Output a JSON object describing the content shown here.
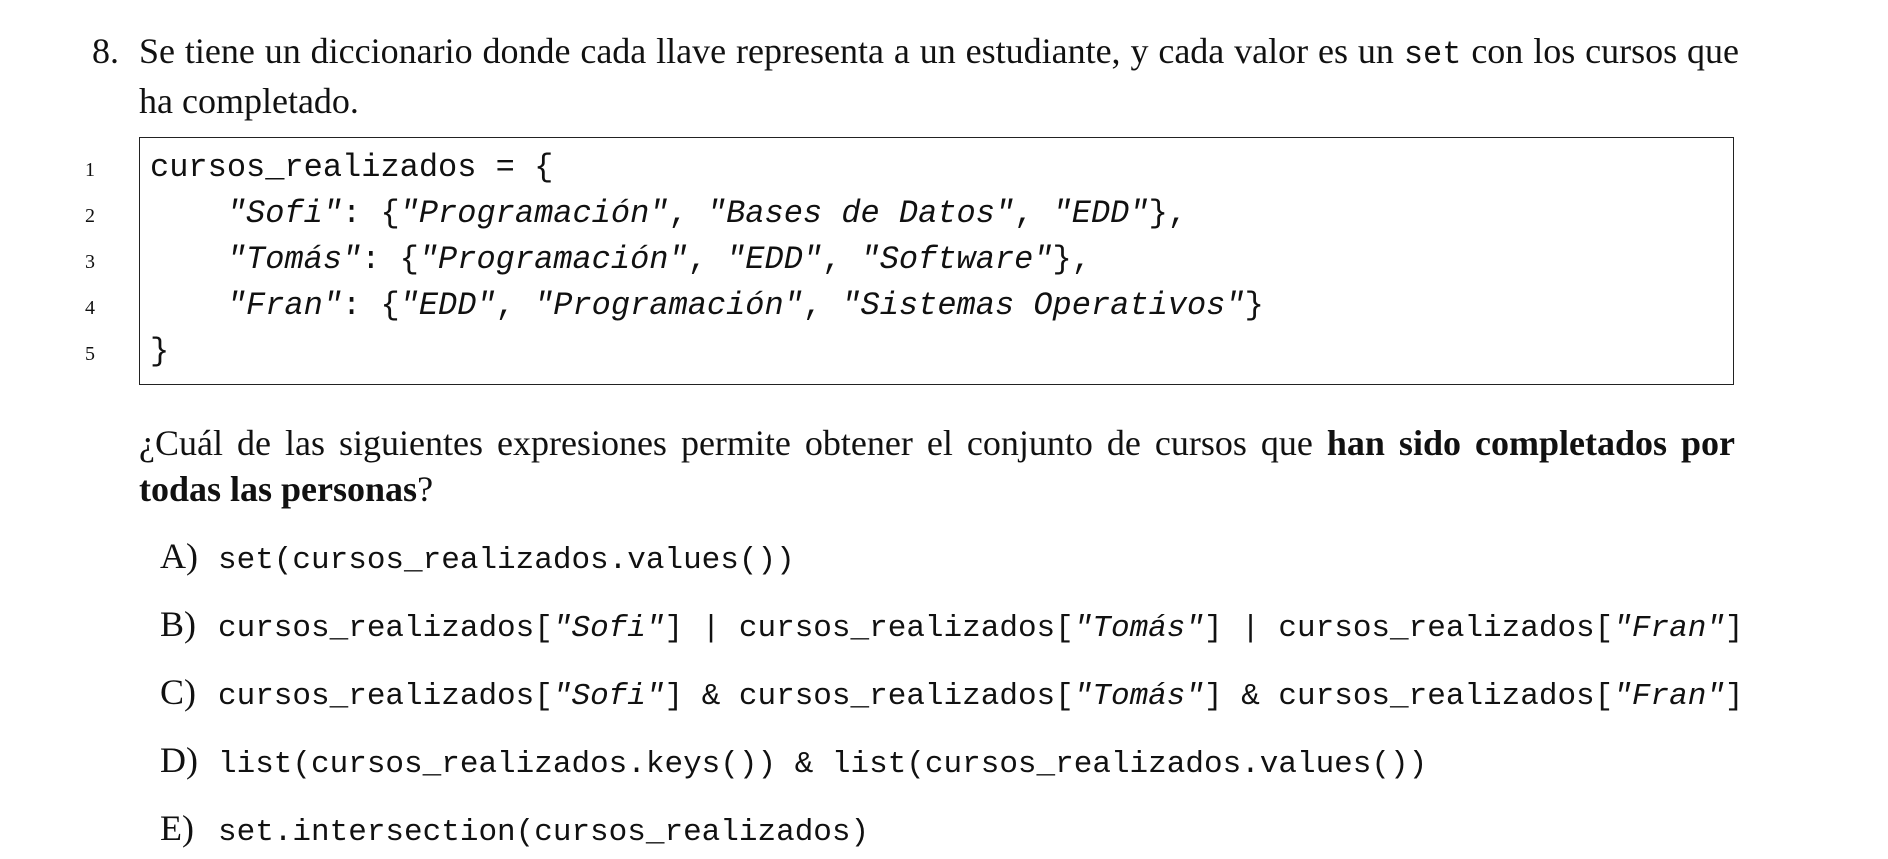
{
  "question": {
    "number": "8.",
    "text_before": "Se tiene un diccionario donde cada llave representa a un estudiante, y cada valor es un ",
    "inline_code": "set",
    "text_after": " con los cursos que ha completado."
  },
  "code": {
    "line_numbers": [
      "1",
      "2",
      "3",
      "4",
      "5"
    ],
    "line1": "cursos_realizados = {",
    "line2": {
      "indent": "    ",
      "key": "\"Sofi\"",
      "sep": ": {",
      "items": [
        "\"Programación\"",
        "\"Bases de Datos\"",
        "\"EDD\""
      ],
      "close": "},"
    },
    "line3": {
      "indent": "    ",
      "key": "\"Tomás\"",
      "sep": ": {",
      "items": [
        "\"Programación\"",
        "\"EDD\"",
        "\"Software\""
      ],
      "close": "},"
    },
    "line4": {
      "indent": "    ",
      "key": "\"Fran\"",
      "sep": ": {",
      "items": [
        "\"EDD\"",
        "\"Programación\"",
        "\"Sistemas Operativos\""
      ],
      "close": "}"
    },
    "line5": "}",
    "comma": ", "
  },
  "prompt": {
    "text_before": "¿Cuál de las siguientes expresiones permite obtener el conjunto de cursos que ",
    "bold": "han sido completados por todas las personas",
    "text_after": "?"
  },
  "options": {
    "a": {
      "letter": "A)",
      "code": "set(cursos_realizados.values())"
    },
    "b": {
      "letter": "B)",
      "p1": "cursos_realizados[",
      "s1": "\"Sofi\"",
      "p2": "] | cursos_realizados[",
      "s2": "\"Tomás\"",
      "p3": "] | cursos_realizados[",
      "s3": "\"Fran\"",
      "p4": "]"
    },
    "c": {
      "letter": "C)",
      "p1": "cursos_realizados[",
      "s1": "\"Sofi\"",
      "p2": "] & cursos_realizados[",
      "s2": "\"Tomás\"",
      "p3": "] & cursos_realizados[",
      "s3": "\"Fran\"",
      "p4": "]"
    },
    "d": {
      "letter": "D)",
      "code": "list(cursos_realizados.keys()) & list(cursos_realizados.values())"
    },
    "e": {
      "letter": "E)",
      "code": "set.intersection(cursos_realizados)"
    }
  }
}
